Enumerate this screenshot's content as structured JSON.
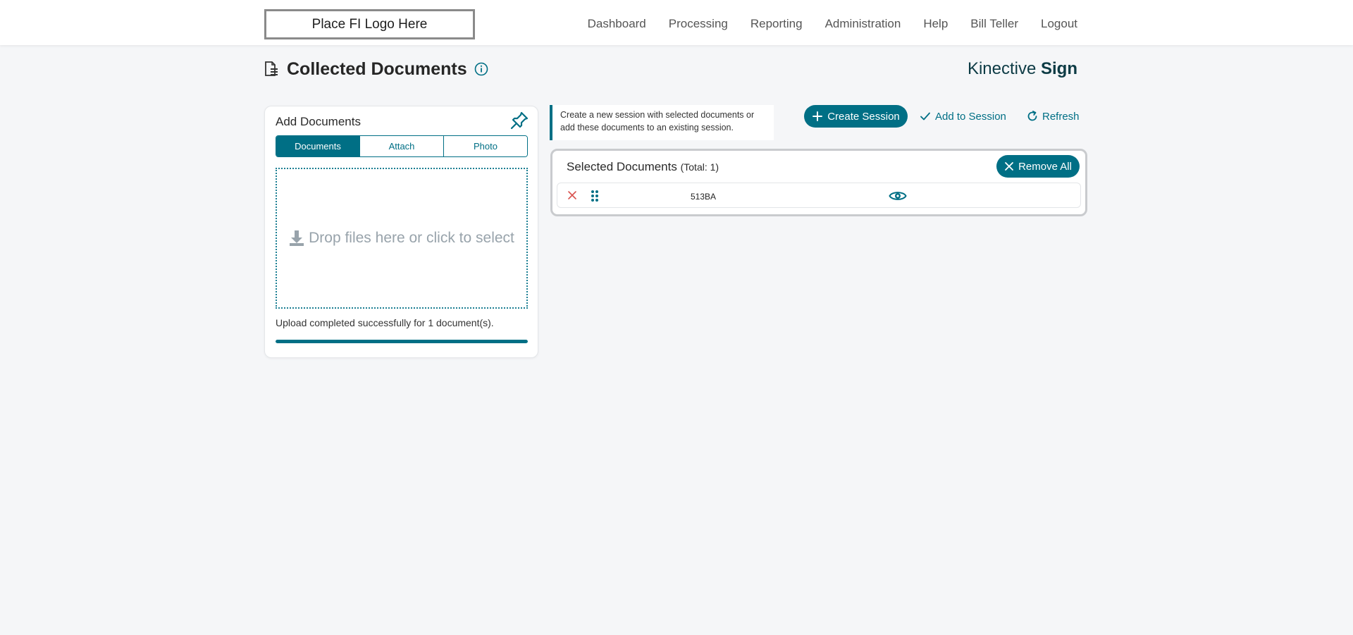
{
  "header": {
    "logo_text": "Place FI Logo Here",
    "nav": [
      "Dashboard",
      "Processing",
      "Reporting",
      "Administration",
      "Help",
      "Bill Teller",
      "Logout"
    ]
  },
  "page": {
    "title": "Collected Documents",
    "brand_light": "Kinective",
    "brand_bold": "Sign"
  },
  "add_documents": {
    "title": "Add Documents",
    "tabs": [
      {
        "label": "Documents",
        "active": true
      },
      {
        "label": "Attach",
        "active": false
      },
      {
        "label": "Photo",
        "active": false
      }
    ],
    "dropzone_text": "Drop files here or click to select",
    "upload_status": "Upload completed successfully for 1 document(s).",
    "upload_progress": 1.0
  },
  "note": {
    "text": "Create a new session with selected documents or add these documents to an existing session."
  },
  "actions": {
    "create_session": "Create Session",
    "add_to_session": "Add to Session",
    "refresh": "Refresh"
  },
  "selected_documents": {
    "title": "Selected Documents",
    "total_label": "(Total: 1)",
    "remove_all": "Remove All",
    "items": [
      {
        "name": "513BA"
      }
    ]
  },
  "colors": {
    "accent": "#006f85",
    "remove_icon": "#d9534f"
  }
}
